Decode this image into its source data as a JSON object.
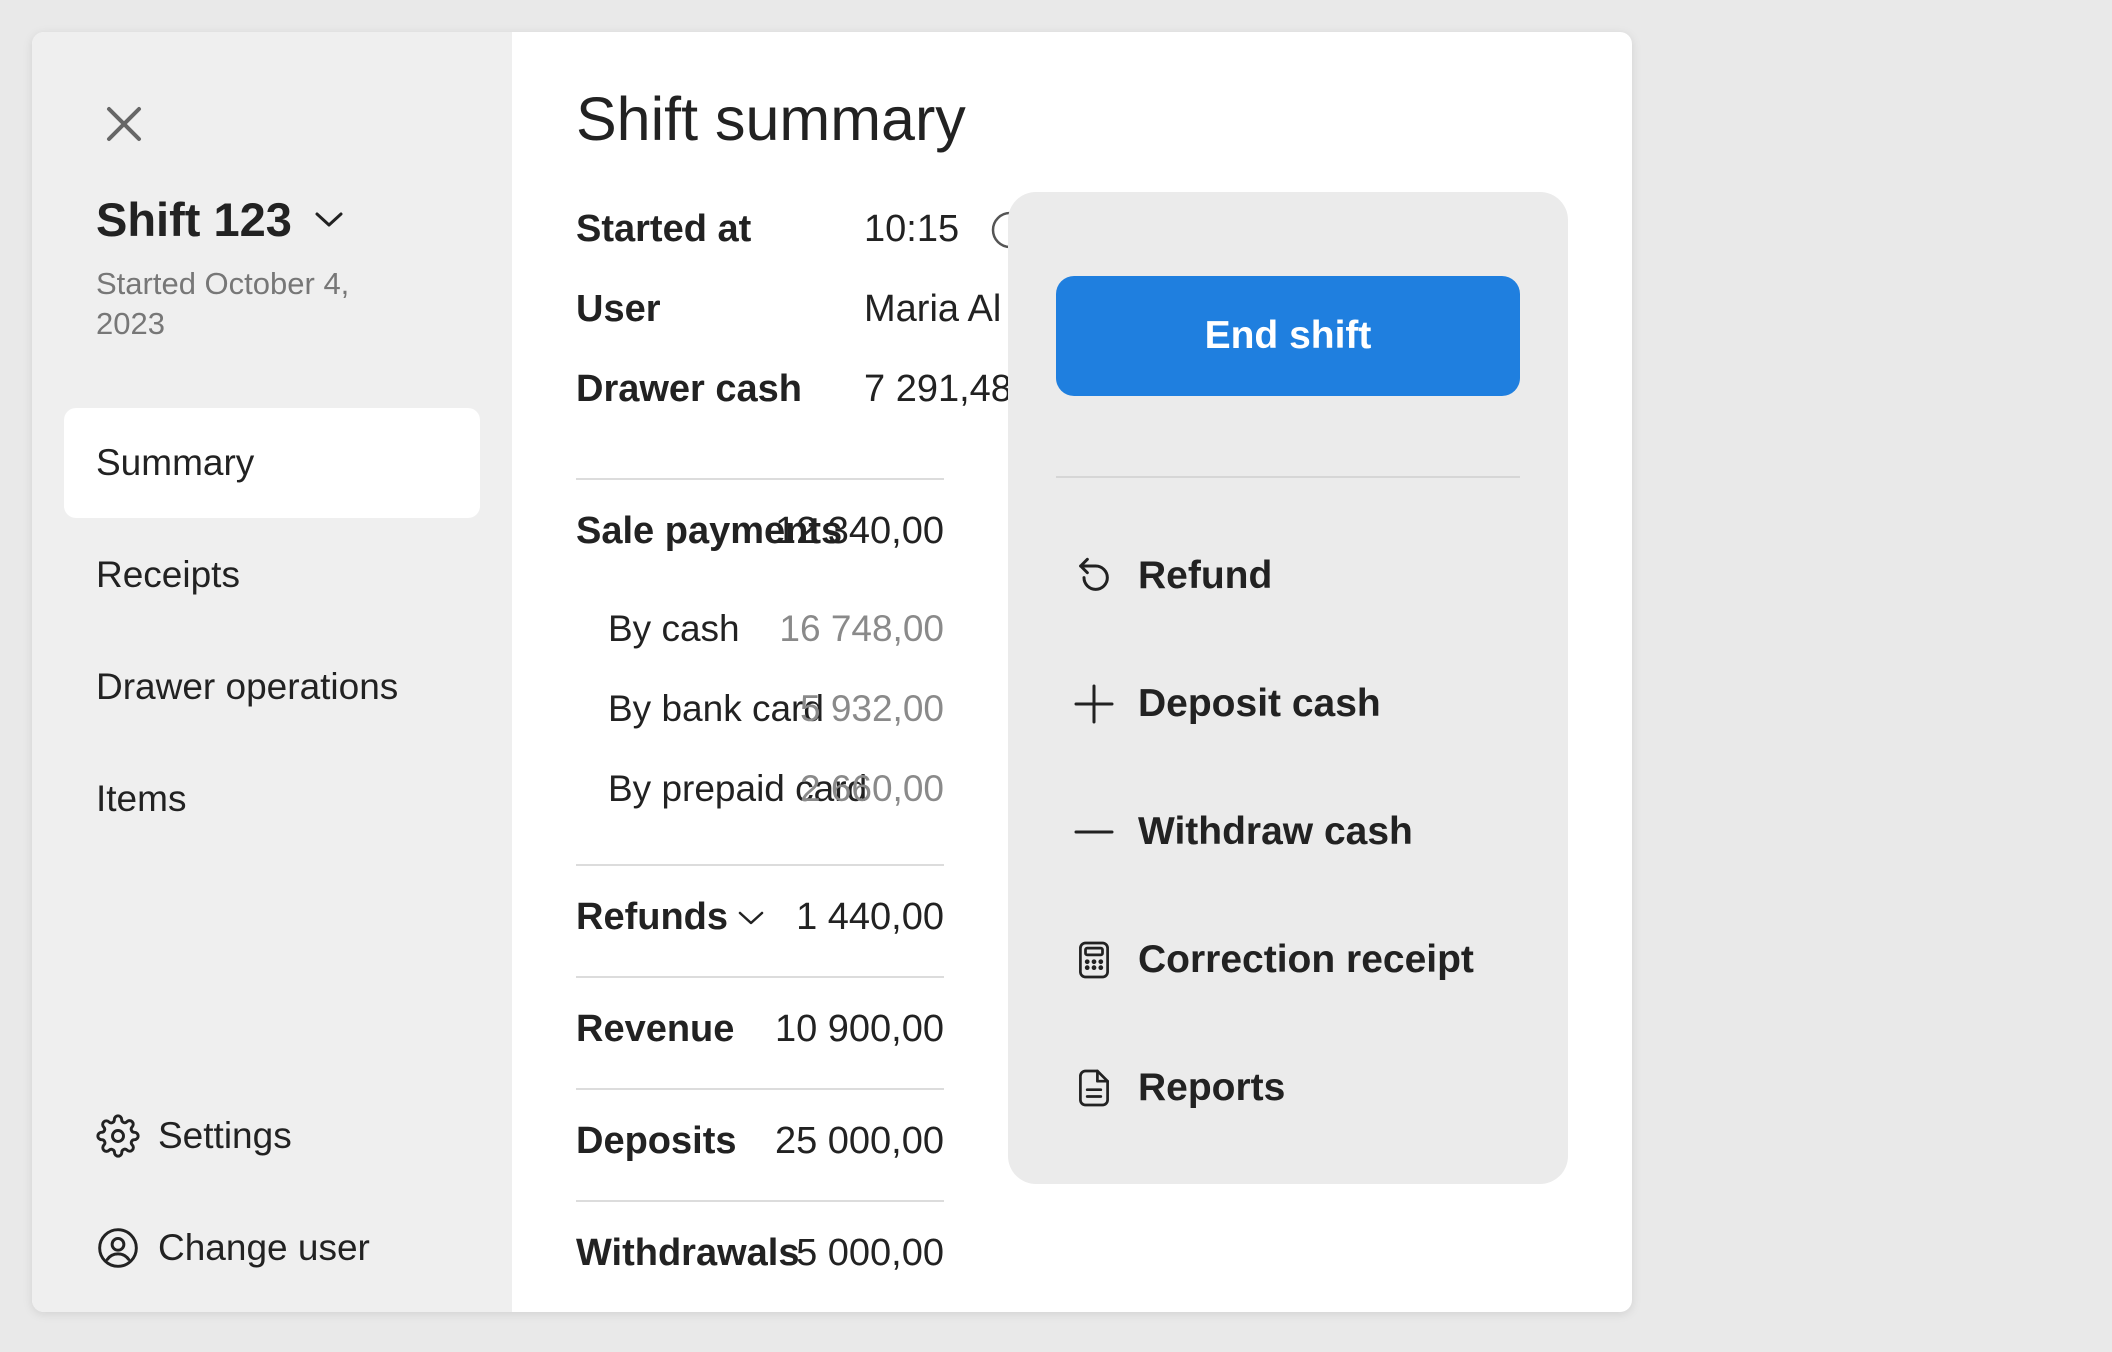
{
  "sidebar": {
    "shift_title": "Shift 123",
    "started": "Started October 4, 2023",
    "nav": [
      {
        "label": "Summary",
        "active": true
      },
      {
        "label": "Receipts"
      },
      {
        "label": "Drawer operations"
      },
      {
        "label": "Items"
      }
    ],
    "settings_label": "Settings",
    "change_user_label": "Change user"
  },
  "summary": {
    "title": "Shift summary",
    "started_label": "Started at",
    "started_value": "10:15",
    "user_label": "User",
    "user_value": "Maria Al",
    "drawer_cash_label": "Drawer cash",
    "drawer_cash_value": "7 291,48",
    "sale_payments_label": "Sale payments",
    "sale_payments_value": "12 340,00",
    "by_cash_label": "By cash",
    "by_cash_value": "16 748,00",
    "by_bank_label": "By bank card",
    "by_bank_value": "5 932,00",
    "by_prepaid_label": "By prepaid card",
    "by_prepaid_value": "2 660,00",
    "refunds_label": "Refunds",
    "refunds_value": "1 440,00",
    "revenue_label": "Revenue",
    "revenue_value": "10 900,00",
    "deposits_label": "Deposits",
    "deposits_value": "25 000,00",
    "withdrawals_label": "Withdrawals",
    "withdrawals_value": "5 000,00"
  },
  "popover": {
    "end_shift_label": "End shift",
    "items": [
      {
        "label": "Refund",
        "icon": "refund-icon"
      },
      {
        "label": "Deposit cash",
        "icon": "plus-icon"
      },
      {
        "label": "Withdraw cash",
        "icon": "minus-icon"
      },
      {
        "label": "Correction receipt",
        "icon": "calculator-icon"
      },
      {
        "label": "Reports",
        "icon": "document-icon"
      }
    ]
  },
  "colors": {
    "accent": "#1f7fdf",
    "sidebar_bg": "#efefef",
    "page_bg": "#e9e9e9",
    "popover_bg": "#ebebeb"
  }
}
